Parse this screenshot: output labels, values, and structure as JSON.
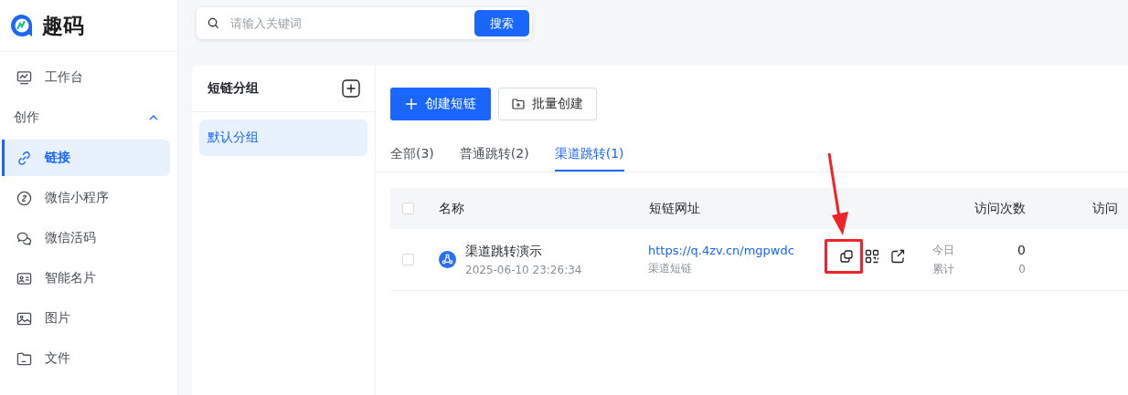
{
  "app": {
    "name": "趣码"
  },
  "sidebar": {
    "items": [
      {
        "kind": "item",
        "label": "工作台",
        "selected": false
      },
      {
        "kind": "section",
        "label": "创作",
        "expanded": true
      },
      {
        "kind": "item",
        "label": "链接",
        "selected": true
      },
      {
        "kind": "item",
        "label": "微信小程序",
        "selected": false
      },
      {
        "kind": "item",
        "label": "微信活码",
        "selected": false
      },
      {
        "kind": "item",
        "label": "智能名片",
        "selected": false
      },
      {
        "kind": "item",
        "label": "图片",
        "selected": false
      },
      {
        "kind": "item",
        "label": "文件",
        "selected": false
      }
    ]
  },
  "search": {
    "placeholder": "请输入关键词",
    "button": "搜索"
  },
  "groups": {
    "title": "短链分组",
    "items": [
      {
        "label": "默认分组",
        "selected": true
      }
    ]
  },
  "buttons": [
    {
      "kind": "primary",
      "label": "创建短链"
    },
    {
      "kind": "secondary",
      "label": "批量创建"
    }
  ],
  "tabs": [
    {
      "label": "全部(3)",
      "selected": false
    },
    {
      "label": "普通跳转(2)",
      "selected": false
    },
    {
      "label": "渠道跳转(1)",
      "selected": true
    }
  ],
  "table": {
    "checked": false,
    "columns": [
      "名称",
      "短链网址",
      "访问次数",
      "访问"
    ],
    "rows": [
      {
        "checked": false,
        "name": "渠道跳转演示",
        "created": "2025-06-10 23:26:34",
        "url": "https://q.4zv.cn/mgpwdc",
        "type": "渠道短链",
        "today_label": "今日",
        "today": "0",
        "total_label": "累计",
        "total": "0"
      }
    ]
  }
}
